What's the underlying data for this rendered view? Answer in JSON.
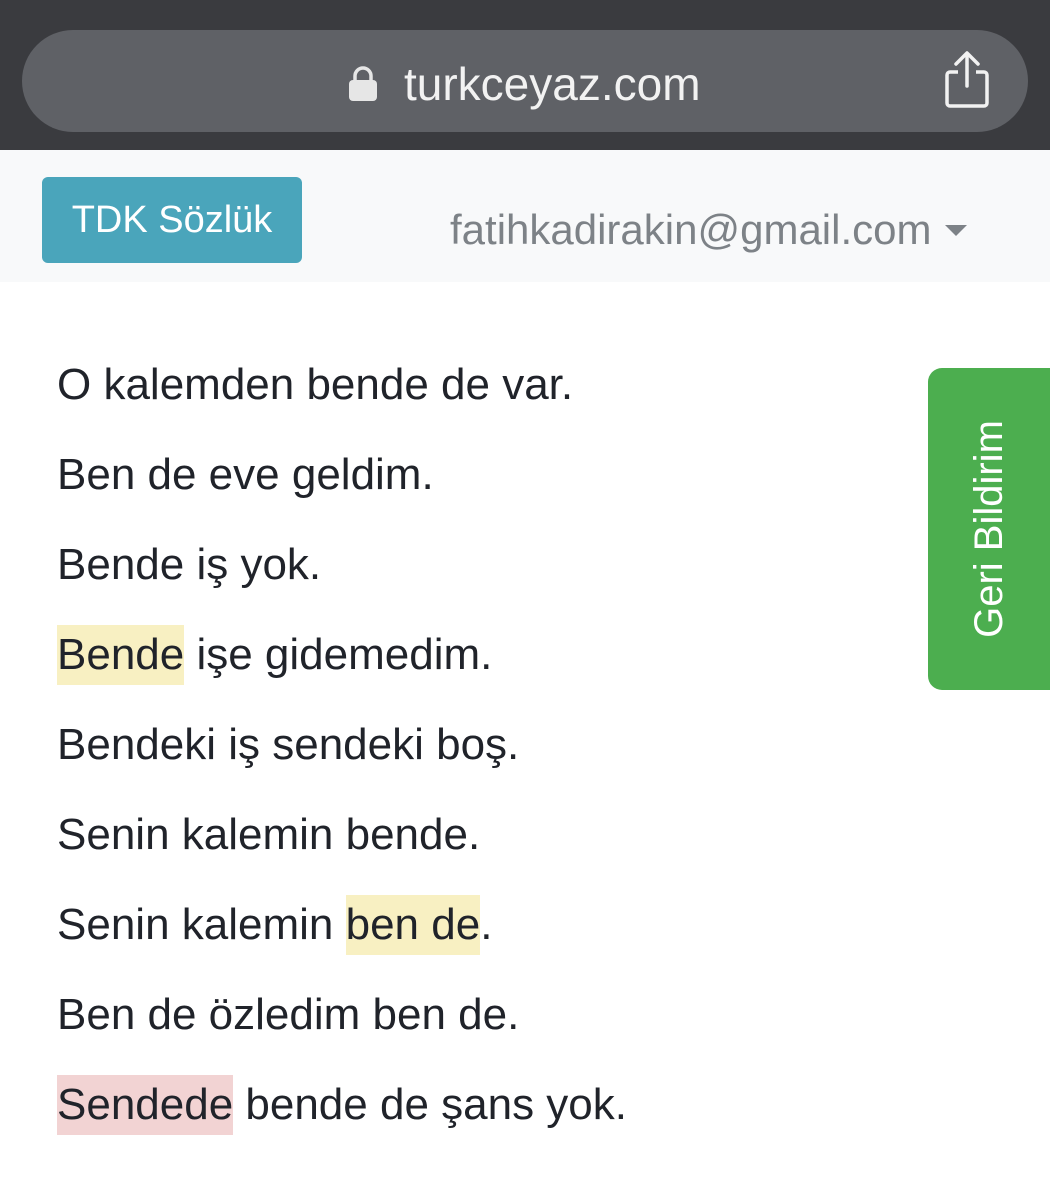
{
  "browser": {
    "url": "turkceyaz.com",
    "lock_icon": "lock-icon",
    "share_icon": "share-icon"
  },
  "navbar": {
    "dictionary_button": "TDK Sözlük",
    "account_email": "fatihkadirakin@gmail.com"
  },
  "feedback_tab": {
    "label": "Geri Bildirim"
  },
  "colors": {
    "highlight_warning": "#f8f0c2",
    "highlight_error": "#f2d3d3",
    "feedback_green": "#4cae4f",
    "button_teal": "#4aa5bb"
  },
  "sentences": [
    {
      "segments": [
        {
          "text": "O kalemden bende de var.",
          "highlight": "none"
        }
      ]
    },
    {
      "segments": [
        {
          "text": "Ben de eve geldim.",
          "highlight": "none"
        }
      ]
    },
    {
      "segments": [
        {
          "text": "Bende iş yok.",
          "highlight": "none"
        }
      ]
    },
    {
      "segments": [
        {
          "text": "Bende",
          "highlight": "warning"
        },
        {
          "text": " işe gidemedim.",
          "highlight": "none"
        }
      ]
    },
    {
      "segments": [
        {
          "text": "Bendeki iş sendeki boş.",
          "highlight": "none"
        }
      ]
    },
    {
      "segments": [
        {
          "text": "Senin kalemin bende.",
          "highlight": "none"
        }
      ]
    },
    {
      "segments": [
        {
          "text": "Senin kalemin ",
          "highlight": "none"
        },
        {
          "text": "ben de",
          "highlight": "warning"
        },
        {
          "text": ".",
          "highlight": "none"
        }
      ]
    },
    {
      "segments": [
        {
          "text": "Ben de özledim ben de.",
          "highlight": "none"
        }
      ]
    },
    {
      "segments": [
        {
          "text": "Sendede",
          "highlight": "error"
        },
        {
          "text": " bende de şans yok.",
          "highlight": "none"
        }
      ]
    }
  ]
}
